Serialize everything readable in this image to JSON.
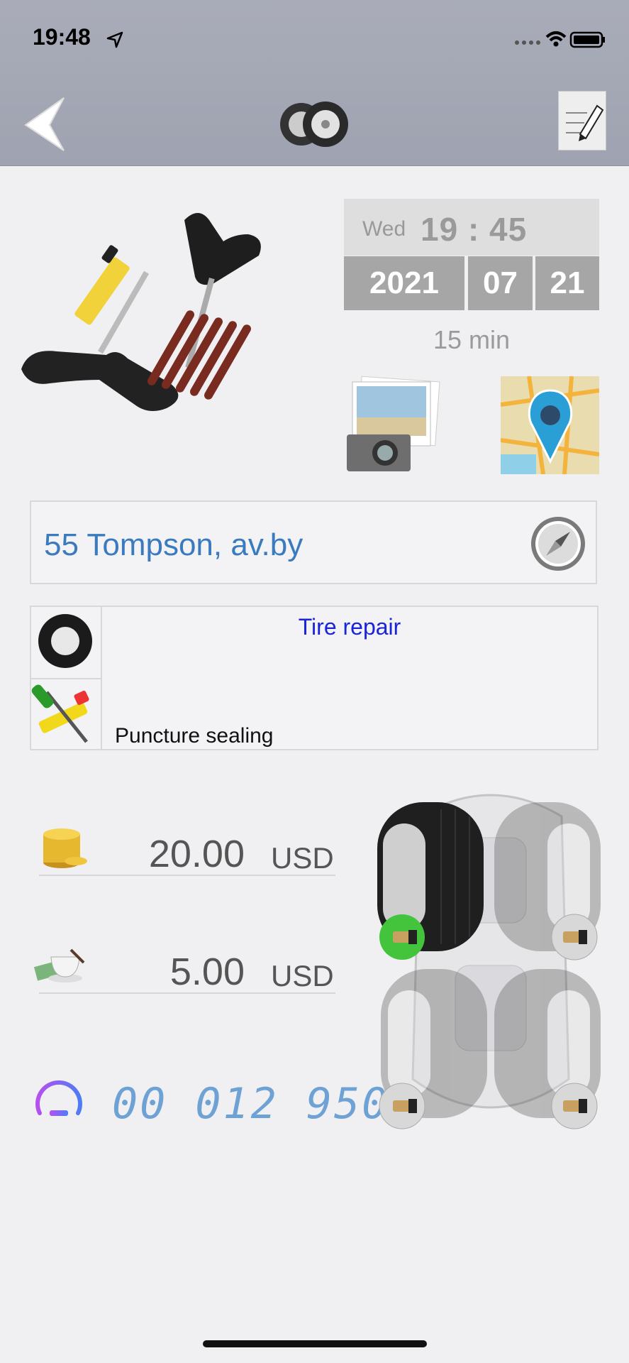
{
  "status_bar": {
    "time": "19:48"
  },
  "icons": {
    "back": "back-arrow-icon",
    "wheels": "wheels-icon",
    "notes": "notepad-edit-icon",
    "photo": "photo-camera-icon",
    "map": "map-location-icon",
    "compass": "compass-icon",
    "tire": "tire-icon",
    "tools": "repair-tools-icon",
    "coins": "coins-icon",
    "tip": "tea-cup-money-icon",
    "odometer": "speedometer-icon"
  },
  "datetime": {
    "day": "Wed",
    "time": "19 : 45",
    "year": "2021",
    "month": "07",
    "date": "21",
    "duration": "15 min"
  },
  "address": {
    "text": "55 Tompson, av.by"
  },
  "service": {
    "title": "Tire repair",
    "subtitle": "Puncture sealing"
  },
  "costs": [
    {
      "value": "20.00",
      "currency": "USD"
    },
    {
      "value": "5.00",
      "currency": "USD"
    }
  ],
  "odometer": {
    "value": "00 012 950"
  },
  "colors": {
    "address": "#3a7bc0",
    "service_title": "#1a24d8",
    "odometer": "#6fa2d4",
    "active_valve": "#44c43c"
  },
  "wheels_state": {
    "front_left": "selected",
    "front_right": "faded",
    "rear_left": "faded",
    "rear_right": "faded"
  }
}
